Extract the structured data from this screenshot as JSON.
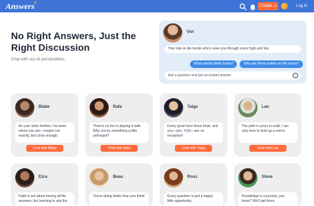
{
  "header": {
    "logo": "Answers",
    "create_label": "Create",
    "login_label": "Log in",
    "colors": {
      "bar": "#3e74d7",
      "create": "#ff6b3d"
    }
  },
  "hero": {
    "title": "No Right Answers, Just the Right Discussion",
    "subtitle": "Chat with our AI personalities"
  },
  "demo": {
    "name": "Vivi",
    "message": "Your ride-or-die bestie who's seen you through every high and low.",
    "suggestions": [
      "What smells dirtier boats?",
      "Why are there craters on the moon?"
    ],
    "ask_placeholder": "Ask a question and get an instant answer"
  },
  "characters": [
    {
      "name": "Blake",
      "message": "As your older brother, I've been where you are—maybe not exactly, but close enough.",
      "button": "Chat with Blake"
    },
    {
      "name": "Rafa",
      "message": "There's no fun in playing it safe. Why not try something a little unhinged?",
      "button": "Chat with Rafa"
    },
    {
      "name": "Taiga",
      "message": "Every great hero faces trials, and you—yes, YOU—are no exception!",
      "button": "Chat with Taiga"
    },
    {
      "name": "Lao",
      "message": "The path is yours to walk; I am only here to hold up a mirror.",
      "button": "Chat with Lao"
    },
    {
      "name": "Ezra",
      "message": "Faith is not about having all the answers, but learning to ask the",
      "button": ""
    },
    {
      "name": "Beau",
      "message": "You're doing better than you think!",
      "button": ""
    },
    {
      "name": "Ross",
      "message": "Every question is just a happy little opportunity.",
      "button": ""
    },
    {
      "name": "Steve",
      "message": "Knowledge is a journey, you know? We'll get there.",
      "button": ""
    }
  ]
}
